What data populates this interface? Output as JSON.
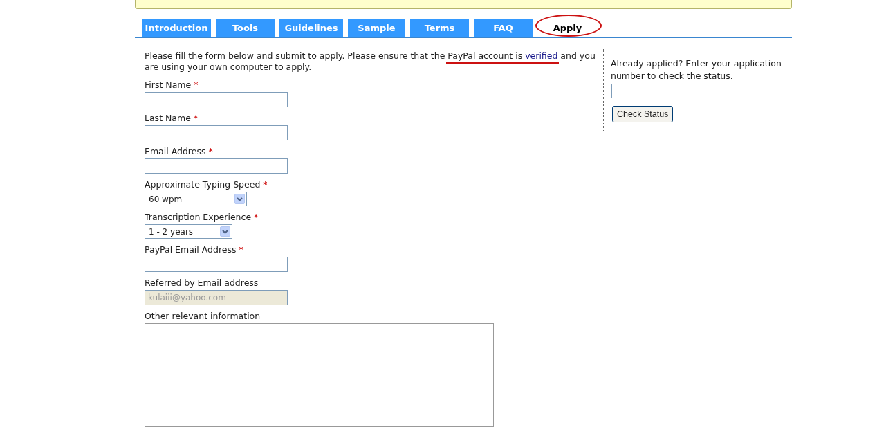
{
  "tabs": [
    {
      "label": "Introduction",
      "selected": false,
      "circled": false
    },
    {
      "label": "Tools",
      "selected": false,
      "circled": false
    },
    {
      "label": "Guidelines",
      "selected": false,
      "circled": false
    },
    {
      "label": "Sample",
      "selected": false,
      "circled": false
    },
    {
      "label": "Terms",
      "selected": false,
      "circled": false
    },
    {
      "label": "FAQ",
      "selected": false,
      "circled": false
    },
    {
      "label": "Apply",
      "selected": true,
      "circled": true
    }
  ],
  "intro": {
    "before": "Please fill the form below and submit to apply. Please ensure that the ",
    "marked": "PayPal account is ",
    "link": "verified",
    "underlined": true,
    "after": " and you are using your own computer to apply."
  },
  "fields": [
    {
      "kind": "text",
      "label": "First Name",
      "required_mark": "*",
      "disabled": false
    },
    {
      "kind": "text",
      "label": "Last Name",
      "required_mark": "*",
      "disabled": false
    },
    {
      "kind": "text",
      "label": "Email Address",
      "required_mark": "*",
      "disabled": false
    },
    {
      "kind": "select",
      "label": "Approximate Typing Speed",
      "required_mark": "*",
      "value": "60 wpm"
    },
    {
      "kind": "select",
      "label": "Transcription Experience",
      "required_mark": "*",
      "value": "1 - 2 years"
    },
    {
      "kind": "text",
      "label": "PayPal Email Address",
      "required_mark": "*",
      "disabled": false
    },
    {
      "kind": "text",
      "label": "Referred by Email address",
      "disabled": true,
      "value": "kulaiii@yahoo.com"
    },
    {
      "kind": "textarea",
      "label": "Other relevant information"
    }
  ],
  "status_check": {
    "prompt": "Already applied? Enter your application number to check the status.",
    "button": "Check Status"
  }
}
